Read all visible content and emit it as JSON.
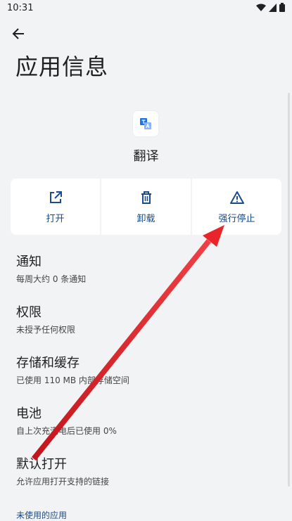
{
  "status_bar": {
    "time": "10:31"
  },
  "header": {
    "title": "应用信息"
  },
  "app": {
    "name": "翻译"
  },
  "actions": [
    {
      "label": "打开",
      "icon": "open-external-icon"
    },
    {
      "label": "卸载",
      "icon": "trash-icon"
    },
    {
      "label": "强行停止",
      "icon": "warning-icon"
    }
  ],
  "settings": [
    {
      "title": "通知",
      "subtitle": "每周大约 0 条通知"
    },
    {
      "title": "权限",
      "subtitle": "未授予任何权限"
    },
    {
      "title": "存储和缓存",
      "subtitle": "已使用 110 MB 内部存储空间"
    },
    {
      "title": "电池",
      "subtitle": "自上次充满电后已使用 0%"
    },
    {
      "title": "默认打开",
      "subtitle": "允许应用打开支持的链接"
    }
  ],
  "section": {
    "unused_apps": "未使用的应用"
  },
  "colors": {
    "accent": "#1a4b8c",
    "annotation_arrow": "#e8252a",
    "background": "#f1f3f4"
  }
}
